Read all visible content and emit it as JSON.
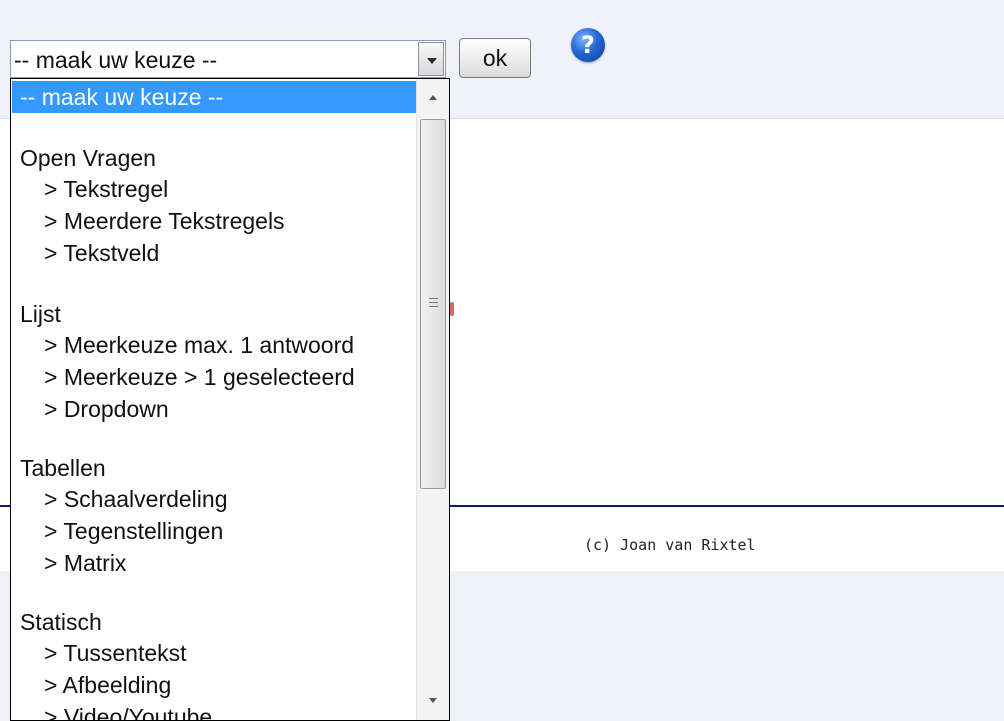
{
  "select": {
    "current_value": "-- maak uw keuze --"
  },
  "ok_button": {
    "label": "ok"
  },
  "help_icon": {
    "glyph": "?",
    "icon": "help-icon",
    "color": "#1f5fd1"
  },
  "dropdown": {
    "options": [
      {
        "label": "-- maak uw keuze --",
        "kind": "placeholder",
        "selected": true
      },
      {
        "label": "Open Vragen",
        "kind": "group"
      },
      {
        "label": "> Tekstregel",
        "kind": "item"
      },
      {
        "label": "> Meerdere Tekstregels",
        "kind": "item"
      },
      {
        "label": "> Tekstveld",
        "kind": "item"
      },
      {
        "label": "Lijst",
        "kind": "group"
      },
      {
        "label": "> Meerkeuze max. 1 antwoord",
        "kind": "item"
      },
      {
        "label": "> Meerkeuze > 1 geselecteerd",
        "kind": "item"
      },
      {
        "label": "> Dropdown",
        "kind": "item"
      },
      {
        "label": "Tabellen",
        "kind": "group"
      },
      {
        "label": "> Schaalverdeling",
        "kind": "item"
      },
      {
        "label": "> Tegenstellingen",
        "kind": "item"
      },
      {
        "label": "> Matrix",
        "kind": "item"
      },
      {
        "label": "Statisch",
        "kind": "group"
      },
      {
        "label": "> Tussentekst",
        "kind": "item"
      },
      {
        "label": "> Afbeelding",
        "kind": "item"
      },
      {
        "label": "> Video/Youtube",
        "kind": "item"
      }
    ]
  },
  "footer": {
    "text": "(c) Joan van Rixtel"
  },
  "colors": {
    "selected_option": "#3399ff",
    "footer_rule": "#0b1b6e"
  }
}
